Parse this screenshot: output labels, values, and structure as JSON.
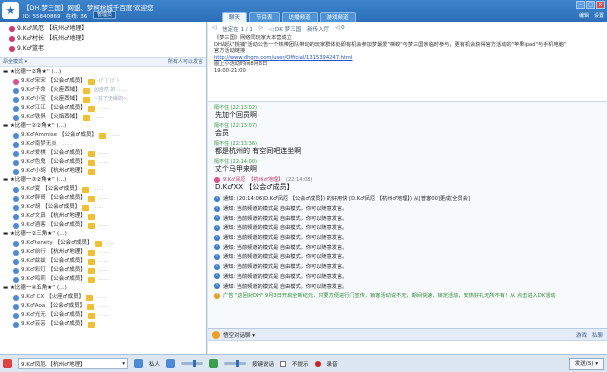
{
  "header": {
    "logo_icon": "game-logo-icon",
    "title": "【DH.梦三国】网盟、梦柯杭城千百度'欢迎您",
    "room_id": "ID: 55840869",
    "online": "在线: 36",
    "manager_label": "管理员"
  },
  "tabs": [
    {
      "label": "聊天",
      "active": true
    },
    {
      "label": "节目表",
      "active": false
    },
    {
      "label": "访播频道",
      "active": false
    },
    {
      "label": "游戏频道",
      "active": false
    }
  ],
  "window_controls": [
    "min",
    "max",
    "close"
  ],
  "toolbar": {
    "edit": "编辑",
    "settings": "设置"
  },
  "pinned": [
    "9.K♂凤厄  【杭州♂地理】",
    "9.K♂村长  【杭州♂地理】",
    "9.K♂篮老"
  ],
  "list_bar": {
    "left": "昂全模式 ▾",
    "right": "所有人可以发言"
  },
  "members": [
    {
      "t": "g",
      "label": "▬ ★比德一②角★'' (…)"
    },
    {
      "t": "m",
      "ic": "f",
      "rk": "9.K♂宋宋",
      "role": "【公会♂成员】",
      "badge": true,
      "sig": "(ﾃﾞ)ﾟ(ﾃﾞ)"
    },
    {
      "t": "m",
      "ic": "m",
      "rk": "9.K♂子命",
      "role": "【火座西域】",
      "badge": true,
      "sig": "凶自然 的 ……"
    },
    {
      "t": "m",
      "ic": "m",
      "rk": "9.K♂小宝",
      "role": "【火座西域】",
      "badge": true,
      "sig": "~在了无缘的~"
    },
    {
      "t": "m",
      "ic": "m",
      "rk": "9.K♂江江",
      "role": "【公会♂成员】",
      "badge": true,
      "sig": "……"
    },
    {
      "t": "m",
      "ic": "m",
      "rk": "9.K♂铁俱",
      "role": "【火焰西域】",
      "badge": true,
      "sig": "……"
    },
    {
      "t": "g",
      "label": "▬ ★比德一②②角★'' (…)"
    },
    {
      "t": "m",
      "ic": "m",
      "rk": "9.K♂Ammise",
      "role": "【公会♂成员】",
      "badge": true,
      "sig": "……"
    },
    {
      "t": "m",
      "ic": "m",
      "rk": "9.K♂南梦无炎",
      "role": "",
      "badge": false,
      "sig": "……"
    },
    {
      "t": "m",
      "ic": "m",
      "rk": "9.K♂爱棋",
      "role": "【公会♂成员】",
      "badge": true,
      "sig": "……"
    },
    {
      "t": "m",
      "ic": "m",
      "rk": "9.K♂色鬼",
      "role": "【公会♂成员】",
      "badge": true,
      "sig": "……"
    },
    {
      "t": "m",
      "ic": "m",
      "rk": "9.K♂小胡",
      "role": "【杭州♂地理】",
      "badge": true,
      "sig": ""
    },
    {
      "t": "g",
      "label": "▬ ★比德一③②角★'' (…)"
    },
    {
      "t": "m",
      "ic": "m",
      "rk": "9.K♂夏",
      "role": "【公会♂成员】",
      "badge": true,
      "sig": "……"
    },
    {
      "t": "m",
      "ic": "m",
      "rk": "9.K♂胖哥",
      "role": "【公会♂成员】",
      "badge": true,
      "sig": "……"
    },
    {
      "t": "m",
      "ic": "m",
      "rk": "9.K♂胡",
      "role": "【公会♂成员】",
      "badge": true,
      "sig": "……"
    },
    {
      "t": "m",
      "ic": "m",
      "rk": "9.K♂文真",
      "role": "【杭州♂地理】",
      "badge": true,
      "sig": ""
    },
    {
      "t": "m",
      "ic": "m",
      "rk": "9.K♂酒客",
      "role": "【公会♂成员】",
      "badge": true,
      "sig": "……"
    },
    {
      "t": "g",
      "label": "▬ ★比德一②三角★'' (…)"
    },
    {
      "t": "m",
      "ic": "m",
      "rk": "9.K♂tenety",
      "role": "【公会♂成员】",
      "badge": true,
      "sig": "……"
    },
    {
      "t": "m",
      "ic": "m",
      "rk": "9.K♂前行",
      "role": "【杭州♂地理】",
      "badge": true,
      "sig": "……"
    },
    {
      "t": "m",
      "ic": "m",
      "rk": "9.K♂兹兹",
      "role": "【公会♂成员】",
      "badge": true,
      "sig": "……"
    },
    {
      "t": "m",
      "ic": "m",
      "rk": "9.K♂彩灯",
      "role": "【公会♂成员】",
      "badge": true,
      "sig": "……"
    },
    {
      "t": "m",
      "ic": "m",
      "rk": "9.K♂鸣莉",
      "role": "【公会♂成员】",
      "badge": true,
      "sig": "……"
    },
    {
      "t": "g",
      "label": "▬ ★比德一④五角★'' (…)"
    },
    {
      "t": "m",
      "ic": "m",
      "rk": "9.K♂ CX",
      "role": "【火座♂成员】",
      "badge": true,
      "sig": "……"
    },
    {
      "t": "m",
      "ic": "m",
      "rk": "9.K♂Aoa",
      "role": "【公会♂成员】",
      "badge": true,
      "sig": "……"
    },
    {
      "t": "m",
      "ic": "m",
      "rk": "9.K♂光无",
      "role": "【公会♂成员】",
      "badge": true,
      "sig": "……"
    },
    {
      "t": "m",
      "ic": "m",
      "rk": "9.K♂芸芸",
      "role": "【公会♂成员】",
      "badge": true,
      "sig": ""
    }
  ],
  "announcement": {
    "nav_prev": "◁",
    "page": "信定在 1 / 1",
    "nav_next": "▷",
    "btn_home": "◁ DK 梦三国",
    "btn_news": "新传入厅",
    "btn_more": "◁ 0",
    "lines": [
      "《梦三国》网络同玩家大本营成立",
      "DH战队\"桃铺\"活动公告一个热带团队带动的玩家群体处即有机会参加梦最爱\"梯蛟\"与梦三国亲临时参与，更有机会获得官方活动的\"苹果ipad\"与手机电脑\"",
      "官方活动链接",
      "http://www.dhgm.com/user/Official/1315394247.html",
      "图上小活动时间8月8日",
      "19:00-21:00"
    ],
    "url_index": 3
  },
  "chat": [
    {
      "kind": "msg",
      "head": "隔不住  (22:13:02)",
      "body": "先加个回员啊"
    },
    {
      "kind": "msg",
      "head": "隔不住  (22:13:07)",
      "body": "会员"
    },
    {
      "kind": "msg",
      "head": "隔不住  (22:13:36)",
      "body": "都是杭州的 有空同吧连坐啊"
    },
    {
      "kind": "msg",
      "head": "隔不住  (22:14:00)",
      "body": "丈个马甲来啊"
    },
    {
      "kind": "member",
      "who": "9.K♂凤厄",
      "role": "【杭州♂地理】",
      "time": "(22:14:08)",
      "body": "D.K♂XX 【公会♂成员】"
    }
  ],
  "system": [
    "通知: (20:14:06)D.K♂凤厄 【公会♂成员】) 的好用快 [D.K♂凤厄 【杭州♂地理】) 从[普客00]更成[全员会]",
    "通知: 当前频道的模式是 自由模式，你可以随意发言。",
    "通知: 当前频道的模式是 自由模式，你可以随意发言。",
    "通知: 当前频道的模式是 自由模式，你可以随意发言。",
    "通知: 当前频道的模式是 自由模式，你可以随意发言。",
    "通知: 当前频道的模式是 自由模式，你可以随意发言。",
    "通知: 当前频道的模式是 自由模式，你可以随意发言。",
    "通知: 当前频道的模式是 自由模式，你可以随意发言。",
    "通知: 当前频道的模式是 自由模式，你可以随意发言。",
    "通知: 当前频道的模式是 自由模式，你可以随意发言。",
    "广告 \"这回对DH\" 9月3日开启全新纪元，只要方便进行门宣传，锁客活动说不无，期间快速，锁定活动，安热好礼无所不有！从 点击进入DK活动"
  ],
  "input_bar": {
    "mode": "悟空对话聊 ▾",
    "btn_game": "游戏",
    "btn_msg": "私聊"
  },
  "bottom": {
    "speaker": "9.K♂凤厄 【杭州♂地理】",
    "self_chat": "私人",
    "only_text": "按键说话",
    "check_label": "不提示",
    "record_label": "录音",
    "send": "发送(S) ▾"
  }
}
